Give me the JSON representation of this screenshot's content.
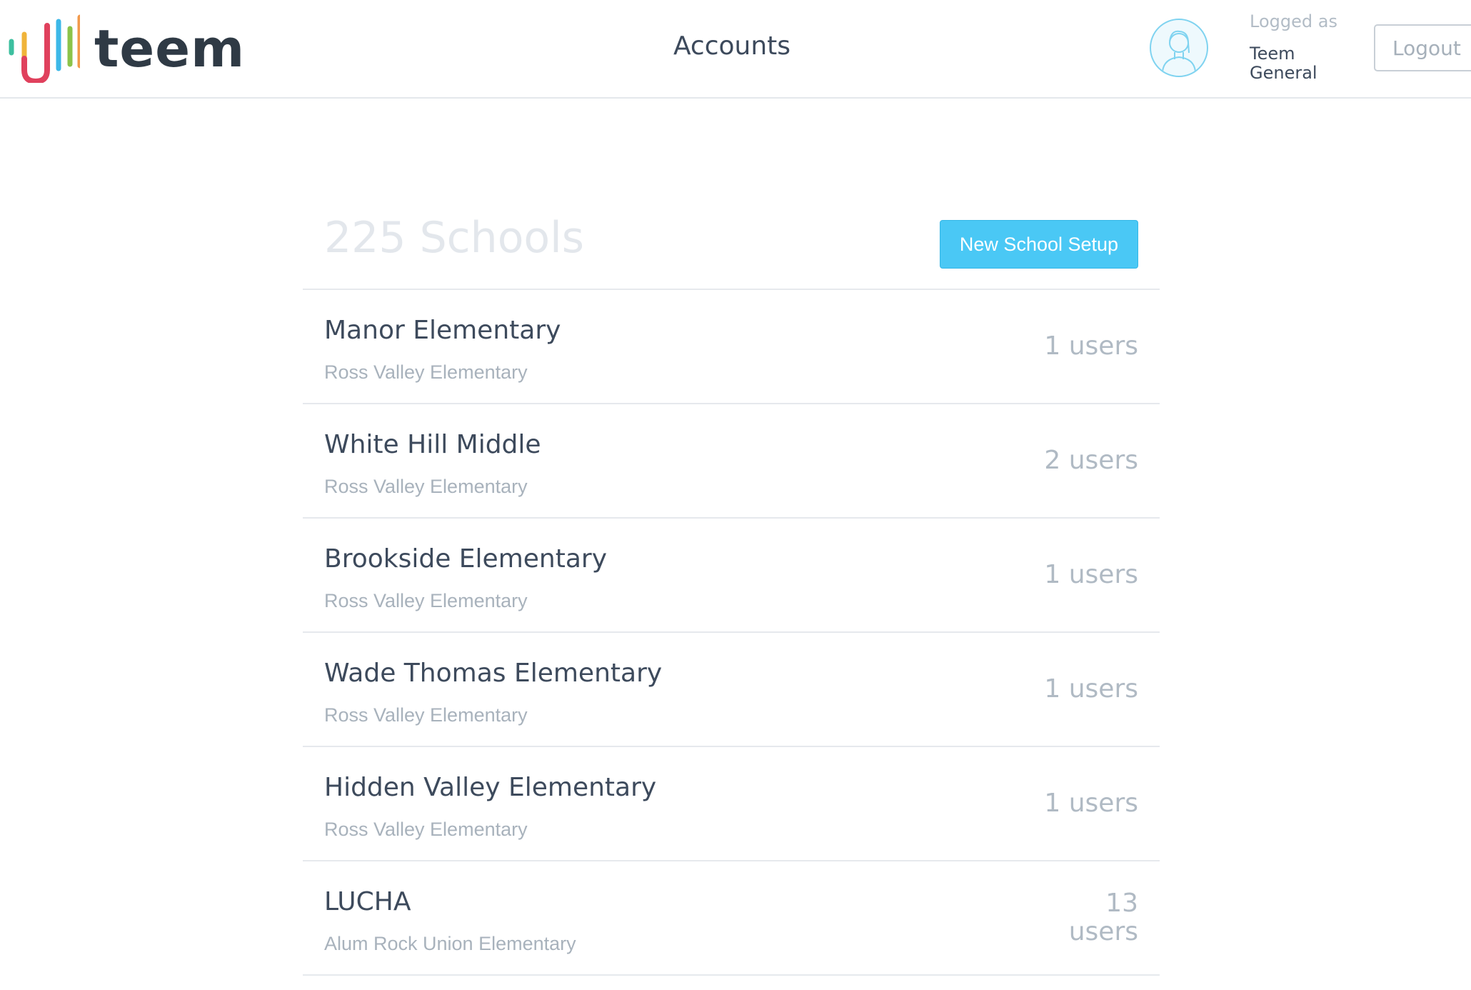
{
  "header": {
    "logo_text": "teem",
    "page_title": "Accounts",
    "logged_as_label": "Logged as",
    "user_name": "Teem General",
    "logout_label": "Logout",
    "avatar_icon": "user-avatar-icon"
  },
  "main": {
    "school_count": "225 Schools",
    "new_school_label": "New School Setup",
    "schools": [
      {
        "name": "Manor Elementary",
        "district": "Ross Valley Elementary",
        "users": "1 users"
      },
      {
        "name": "White Hill Middle",
        "district": "Ross Valley Elementary",
        "users": "2 users"
      },
      {
        "name": "Brookside Elementary",
        "district": "Ross Valley Elementary",
        "users": "1 users"
      },
      {
        "name": "Wade Thomas Elementary",
        "district": "Ross Valley Elementary",
        "users": "1 users"
      },
      {
        "name": "Hidden Valley Elementary",
        "district": "Ross Valley Elementary",
        "users": "1 users"
      },
      {
        "name": "LUCHA",
        "district": "Alum Rock Union Elementary",
        "users": "13 users"
      }
    ]
  },
  "colors": {
    "accent": "#4ac8f5",
    "logo_bars": [
      "#3dbf9f",
      "#f0b43a",
      "#e0415d",
      "#3db8e8",
      "#8bc34a",
      "#f2994a"
    ]
  }
}
